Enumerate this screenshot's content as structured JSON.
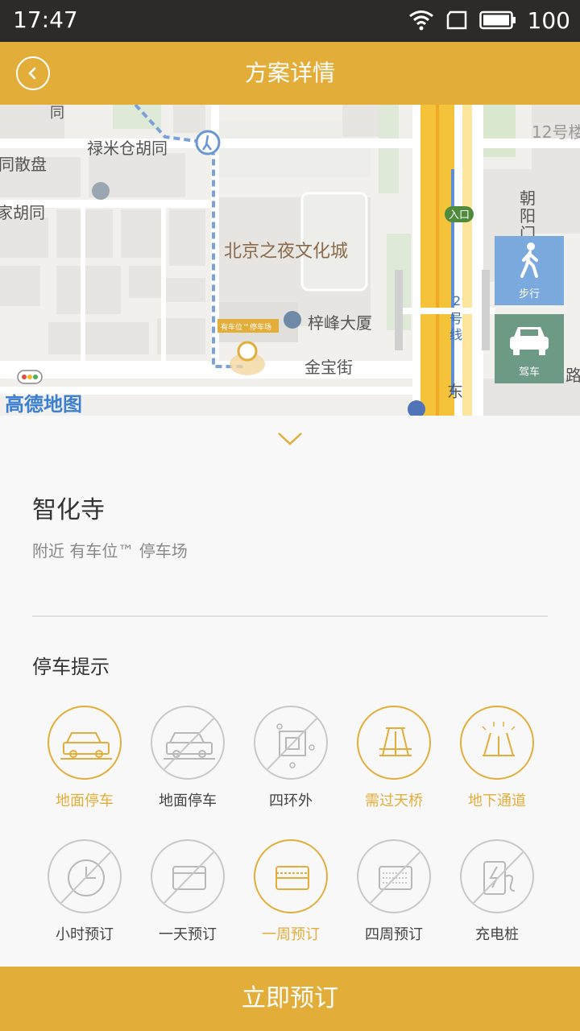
{
  "status": {
    "time": "17:47",
    "battery": "100"
  },
  "header": {
    "title": "方案详情"
  },
  "map": {
    "labels": [
      "禄米仓胡同",
      "同散盘",
      "家胡同",
      "北京之夜文化城",
      "梓峰大厦",
      "金宝街",
      "12号楼",
      "朝",
      "阳",
      "门",
      "入口",
      "2",
      "号",
      "线",
      "东",
      "路",
      "同",
      "有车位™停车场"
    ],
    "logo": "高德地图",
    "walk_label": "步行",
    "drive_label": "驾车"
  },
  "place": {
    "name": "智化寺",
    "subtitle": "附近 有车位™ 停车场"
  },
  "tips": {
    "title": "停车提示",
    "items": [
      {
        "label": "地面停车",
        "active": true,
        "icon": "car-icon"
      },
      {
        "label": "地面停车",
        "active": false,
        "icon": "car-icon"
      },
      {
        "label": "四环外",
        "active": false,
        "icon": "ring-road-icon"
      },
      {
        "label": "需过天桥",
        "active": true,
        "icon": "overpass-icon"
      },
      {
        "label": "地下通道",
        "active": true,
        "icon": "underpass-icon"
      },
      {
        "label": "小时预订",
        "active": false,
        "icon": "clock-icon"
      },
      {
        "label": "一天预订",
        "active": false,
        "icon": "day-card-icon"
      },
      {
        "label": "一周预订",
        "active": true,
        "icon": "week-card-icon"
      },
      {
        "label": "四周预订",
        "active": false,
        "icon": "month-card-icon"
      },
      {
        "label": "充电桩",
        "active": false,
        "icon": "charging-icon"
      }
    ]
  },
  "actions": {
    "book_label": "立即预订"
  },
  "colors": {
    "accent": "#e3ad39",
    "walk": "#7aa9dd",
    "drive": "#6d9a84"
  }
}
